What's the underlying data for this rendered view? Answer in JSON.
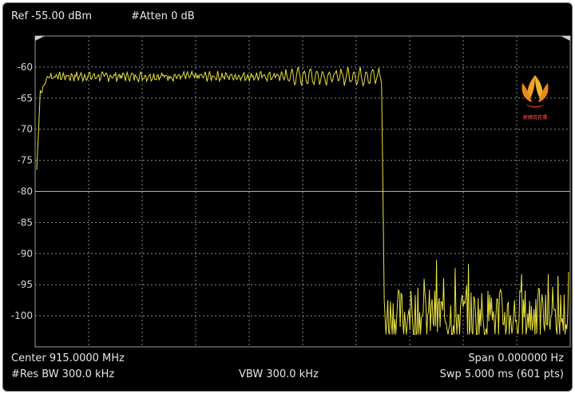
{
  "header": {
    "ref_label": "Ref -55.00 dBm",
    "atten_label": "#Atten 0 dB"
  },
  "y_axis": {
    "tick_labels": [
      "-60",
      "-65",
      "-70",
      "-75",
      "-80",
      "-85",
      "-90",
      "-95",
      "-100"
    ]
  },
  "footer": {
    "center": "Center 915.0000 MHz",
    "span": "Span 0.000000  Hz",
    "rbw": "#Res BW 300.0 kHz",
    "vbw": "VBW 300.0 kHz",
    "sweep": "Swp 5.000 ms (601 pts)"
  },
  "trace": {
    "color": "#e8e040",
    "display_line_color": "#9acb6a",
    "on_level_dbm": -61.5,
    "off_level_dbm": -100,
    "fall_point_index": 390
  },
  "logo": {
    "text": "射频百花谭"
  }
}
